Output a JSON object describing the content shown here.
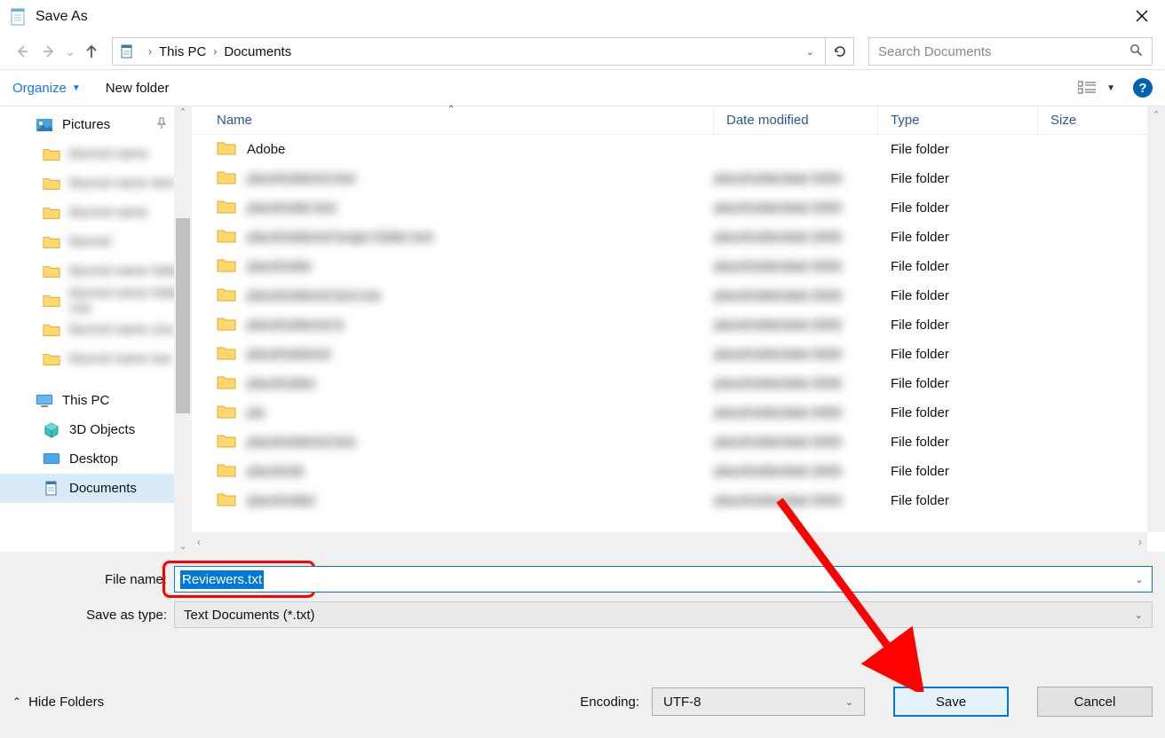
{
  "title": "Save As",
  "breadcrumb": {
    "loc1": "This PC",
    "loc2": "Documents"
  },
  "search": {
    "placeholder": "Search Documents"
  },
  "toolbar": {
    "organize": "Organize",
    "newfolder": "New folder"
  },
  "sidebar": {
    "pictures": "Pictures",
    "thispc": "This PC",
    "objects3d": "3D Objects",
    "desktop": "Desktop",
    "documents": "Documents"
  },
  "columns": {
    "name": "Name",
    "date": "Date modified",
    "type": "Type",
    "size": "Size"
  },
  "rows": {
    "adobe": "Adobe",
    "type_label": "File folder"
  },
  "form": {
    "filename_label": "File name:",
    "filename_value": "Reviewers.txt",
    "saveastype_label": "Save as type:",
    "saveastype_value": "Text Documents (*.txt)",
    "encoding_label": "Encoding:",
    "encoding_value": "UTF-8",
    "hide_folders": "Hide Folders",
    "save": "Save",
    "cancel": "Cancel"
  }
}
